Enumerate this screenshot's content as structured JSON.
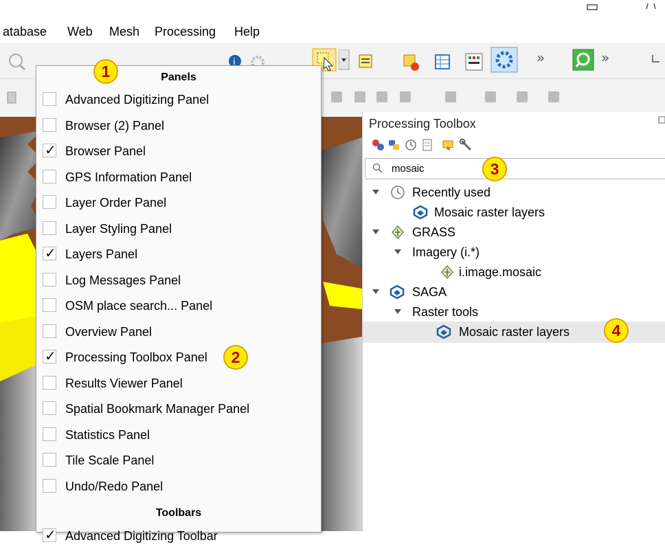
{
  "menubar": {
    "items": [
      "atabase",
      "Web",
      "Mesh",
      "Processing",
      "Help"
    ]
  },
  "window": {
    "minimize_icon": "minimize-icon",
    "close_icon": "close-icon"
  },
  "toolbar": {
    "overflow_label": "»"
  },
  "panels_menu": {
    "panels_header": "Panels",
    "toolbars_header": "Toolbars",
    "items": [
      {
        "label": "Advanced Digitizing Panel",
        "checked": false
      },
      {
        "label": "Browser (2) Panel",
        "checked": false
      },
      {
        "label": "Browser Panel",
        "checked": true
      },
      {
        "label": "GPS Information Panel",
        "checked": false
      },
      {
        "label": "Layer Order Panel",
        "checked": false
      },
      {
        "label": "Layer Styling Panel",
        "checked": false
      },
      {
        "label": "Layers Panel",
        "checked": true
      },
      {
        "label": "Log Messages Panel",
        "checked": false
      },
      {
        "label": "OSM place search... Panel",
        "checked": false
      },
      {
        "label": "Overview Panel",
        "checked": false
      },
      {
        "label": "Processing Toolbox Panel",
        "checked": true
      },
      {
        "label": "Results Viewer Panel",
        "checked": false
      },
      {
        "label": "Spatial Bookmark Manager Panel",
        "checked": false
      },
      {
        "label": "Statistics Panel",
        "checked": false
      },
      {
        "label": "Tile Scale Panel",
        "checked": false
      },
      {
        "label": "Undo/Redo Panel",
        "checked": false
      }
    ],
    "toolbar_items": [
      {
        "label": "Advanced Digitizing Toolbar",
        "checked": true
      }
    ]
  },
  "toolbox": {
    "title": "Processing Toolbox",
    "search": {
      "value": "mosaic"
    },
    "tree": {
      "recently_used": "Recently used",
      "recent_item": "Mosaic raster layers",
      "grass": "GRASS",
      "imagery": "Imagery (i.*)",
      "grass_item": "i.image.mosaic",
      "saga": "SAGA",
      "raster_tools": "Raster tools",
      "saga_item": "Mosaic raster layers"
    }
  },
  "annotations": [
    "1",
    "2",
    "3",
    "4"
  ],
  "colors": {
    "badge_fill": "#ffeb00",
    "badge_text": "#c00000",
    "map_brown": "#8a4a24",
    "map_yellow": "#ffff00"
  }
}
